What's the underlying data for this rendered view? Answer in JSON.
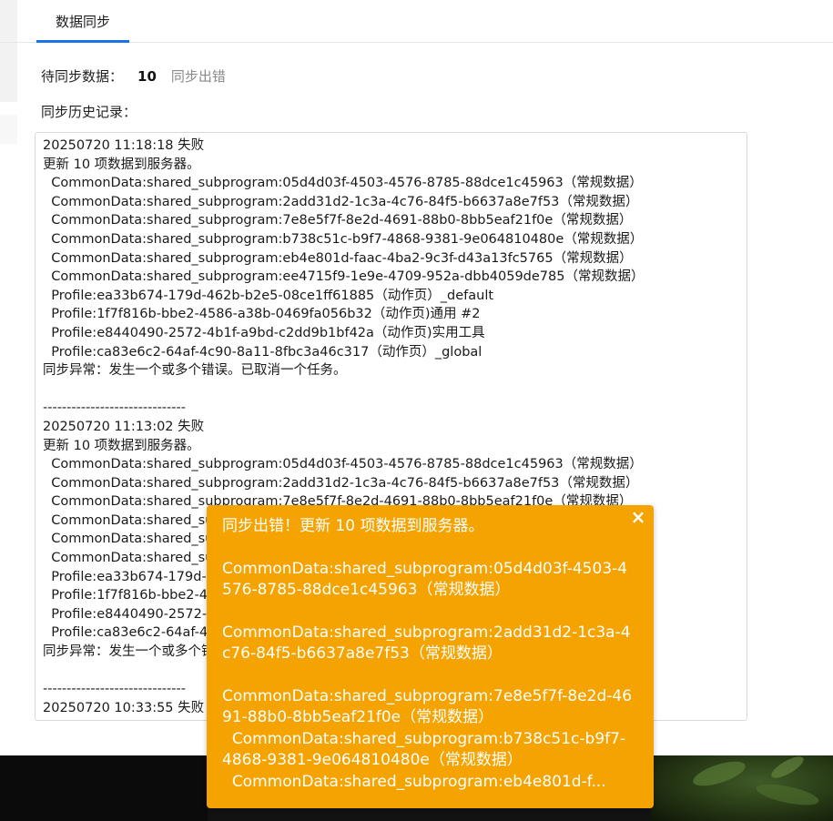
{
  "tab": {
    "label": "数据同步"
  },
  "pending": {
    "label": "待同步数据：",
    "count": "10",
    "error_link": "同步出错"
  },
  "history": {
    "label": "同步历史记录："
  },
  "log_lines": [
    "20250720 11:18:18 失败",
    "更新 10 项数据到服务器。",
    "  CommonData:shared_subprogram:05d4d03f-4503-4576-8785-88dce1c45963（常规数据）",
    "  CommonData:shared_subprogram:2add31d2-1c3a-4c76-84f5-b6637a8e7f53（常规数据）",
    "  CommonData:shared_subprogram:7e8e5f7f-8e2d-4691-88b0-8bb5eaf21f0e（常规数据）",
    "  CommonData:shared_subprogram:b738c51c-b9f7-4868-9381-9e064810480e（常规数据）",
    "  CommonData:shared_subprogram:eb4e801d-faac-4ba2-9c3f-d43a13fc5765（常规数据）",
    "  CommonData:shared_subprogram:ee4715f9-1e9e-4709-952a-dbb4059de785（常规数据）",
    "  Profile:ea33b674-179d-462b-b2e5-08ce1ff61885（动作页）_default",
    "  Profile:1f7f816b-bbe2-4586-a38b-0469fa056b32（动作页)通用 #2",
    "  Profile:e8440490-2572-4b1f-a9bd-c2dd9b1bf42a（动作页)实用工具",
    "  Profile:ca83e6c2-64af-4c90-8a11-8fbc3a46c317（动作页）_global",
    "同步异常：发生一个或多个错误。已取消一个任务。",
    "",
    "------------------------------",
    "20250720 11:13:02 失败",
    "更新 10 项数据到服务器。",
    "  CommonData:shared_subprogram:05d4d03f-4503-4576-8785-88dce1c45963（常规数据）",
    "  CommonData:shared_subprogram:2add31d2-1c3a-4c76-84f5-b6637a8e7f53（常规数据）",
    "  CommonData:shared_subprogram:7e8e5f7f-8e2d-4691-88b0-8bb5eaf21f0e（常规数据）",
    "  CommonData:shared_subprogram:b738c51c-b9f7-4868-9381-9e064810480e（常规数据）",
    "  CommonData:shared_subprogram:eb4e801d-faac-4ba2-9c3f-d43a13fc5765（常规数据）",
    "  CommonData:shared_subprogram:ee4715f9-1e9e-4709-952a-dbb4059de785（常规数据）",
    "  Profile:ea33b674-179d-462b-b2e5-08ce1ff61885（动作页）_default",
    "  Profile:1f7f816b-bbe2-4586-a38b-0469fa056b32（动作页)通用 #2",
    "  Profile:e8440490-2572-4b1f-a9bd-c2dd9b1bf42a（动作页)实用工具",
    "  Profile:ca83e6c2-64af-4c90-8a11-8fbc3a46c317（动作页）_global",
    "同步异常：发生一个或多个错误。已取消一个任务。",
    "",
    "------------------------------",
    "20250720 10:33:55 失败"
  ],
  "toast": {
    "title": "同步出错！更新 10 项数据到服务器。",
    "items": [
      "CommonData:shared_subprogram:05d4d03f-4503-4576-8785-88dce1c45963（常规数据）",
      "CommonData:shared_subprogram:2add31d2-1c3a-4c76-84f5-b6637a8e7f53（常规数据）"
    ],
    "tail": "CommonData:shared_subprogram:7e8e5f7f-8e2d-4691-88b0-8bb5eaf21f0e（常规数据）\n  CommonData:shared_subprogram:b738c51c-b9f7-4868-9381-9e064810480e（常规数据）\n  CommonData:shared_subprogram:eb4e801d-f...",
    "close_symbol": "×"
  },
  "colors": {
    "accent": "#1a73e8",
    "toast_bg": "#f4a300",
    "muted_link": "#8a8a8a"
  },
  "icons": {
    "toast_close": "close-icon"
  }
}
